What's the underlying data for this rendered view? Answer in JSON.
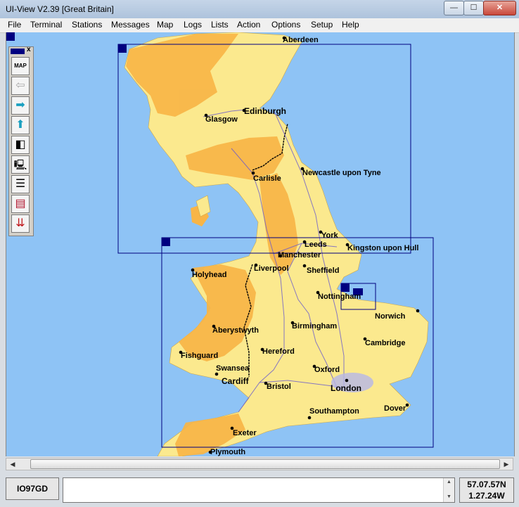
{
  "window": {
    "title": "UI-View V2.39 [Great Britain]",
    "controls": {
      "minimize": "—",
      "maximize": "☐",
      "close": "✕"
    }
  },
  "menu": [
    "File",
    "Terminal",
    "Stations",
    "Messages",
    "Map",
    "Logs",
    "Lists",
    "Action",
    "Options",
    "Setup",
    "Help"
  ],
  "toolbox": {
    "close": "x",
    "tools": [
      {
        "name": "map-tool",
        "label": "MAP",
        "icon": "map-icon"
      },
      {
        "name": "back-tool",
        "label": "⇦",
        "icon": "back-arrow-icon"
      },
      {
        "name": "right-tool",
        "label": "➡",
        "icon": "right-arrow-icon"
      },
      {
        "name": "up-tool",
        "label": "⬆",
        "icon": "up-arrow-icon"
      },
      {
        "name": "window-tool",
        "label": "◧",
        "icon": "window-icon"
      },
      {
        "name": "terminal-tool",
        "label": "🖳",
        "icon": "computer-icon"
      },
      {
        "name": "list-tool",
        "label": "☰",
        "icon": "list-icon"
      },
      {
        "name": "weather-tool",
        "label": "▤",
        "icon": "weather-icon"
      },
      {
        "name": "beacon-tool",
        "label": "⇊",
        "icon": "beacon-icon"
      }
    ]
  },
  "map": {
    "cities": [
      {
        "id": "aberdeen",
        "label": "Aberdeen"
      },
      {
        "id": "edinburgh",
        "label": "Edinburgh"
      },
      {
        "id": "glasgow",
        "label": "Glasgow"
      },
      {
        "id": "newcastle",
        "label": "Newcastle upon Tyne"
      },
      {
        "id": "carlisle",
        "label": "Carlisle"
      },
      {
        "id": "york",
        "label": "York"
      },
      {
        "id": "leeds",
        "label": "Leeds"
      },
      {
        "id": "kingston",
        "label": "Kingston upon Hull"
      },
      {
        "id": "manchester",
        "label": "Manchester"
      },
      {
        "id": "liverpool",
        "label": "Liverpool"
      },
      {
        "id": "holyhead",
        "label": "Holyhead"
      },
      {
        "id": "sheffield",
        "label": "Sheffield"
      },
      {
        "id": "nottingham",
        "label": "Nottingham"
      },
      {
        "id": "norwich",
        "label": "Norwich"
      },
      {
        "id": "birmingham",
        "label": "Birmingham"
      },
      {
        "id": "aberystwyth",
        "label": "Aberystwyth"
      },
      {
        "id": "cambridge",
        "label": "Cambridge"
      },
      {
        "id": "hereford",
        "label": "Hereford"
      },
      {
        "id": "fishguard",
        "label": "Fishguard"
      },
      {
        "id": "swansea",
        "label": "Swansea"
      },
      {
        "id": "oxford",
        "label": "Oxford"
      },
      {
        "id": "cardiff",
        "label": "Cardiff"
      },
      {
        "id": "bristol",
        "label": "Bristol"
      },
      {
        "id": "london",
        "label": "London"
      },
      {
        "id": "southampton",
        "label": "Southampton"
      },
      {
        "id": "dover",
        "label": "Dover"
      },
      {
        "id": "exeter",
        "label": "Exeter"
      },
      {
        "id": "plymouth",
        "label": "Plymouth"
      }
    ]
  },
  "status": {
    "locator": "IO97GD",
    "message": "",
    "latitude": "57.07.57N",
    "longitude": "1.27.24W"
  },
  "colors": {
    "sea": "#8ec3f5",
    "lowland": "#fbe98e",
    "upland": "#f8b547",
    "frame": "#000080"
  }
}
